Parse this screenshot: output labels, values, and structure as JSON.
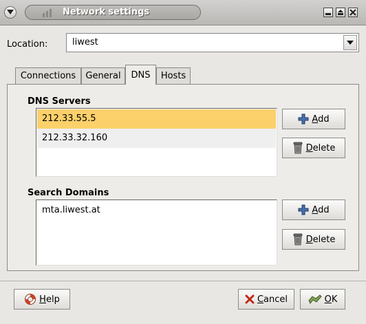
{
  "window": {
    "title": "Network settings",
    "icons": [
      "window-menu-icon",
      "network-icon",
      "minimize-icon",
      "maximize-icon",
      "close-icon"
    ]
  },
  "location": {
    "label": "Location:",
    "value": "liwest"
  },
  "tabs": [
    {
      "label": "Connections",
      "active": false
    },
    {
      "label": "General",
      "active": false
    },
    {
      "label": "DNS",
      "active": true
    },
    {
      "label": "Hosts",
      "active": false
    }
  ],
  "dns_servers": {
    "title": "DNS Servers",
    "items": [
      "212.33.55.5",
      "212.33.32.160"
    ],
    "selected_index": 0,
    "add_label": "Add",
    "delete_label": "Delete"
  },
  "search_domains": {
    "title": "Search Domains",
    "items": [
      "mta.liwest.at"
    ],
    "add_label": "Add",
    "delete_label": "Delete"
  },
  "footer": {
    "help_label": "Help",
    "cancel_label": "Cancel",
    "ok_label": "OK"
  },
  "colors": {
    "selection": "#fcd06a",
    "window_bg": "#e9e7e3"
  }
}
